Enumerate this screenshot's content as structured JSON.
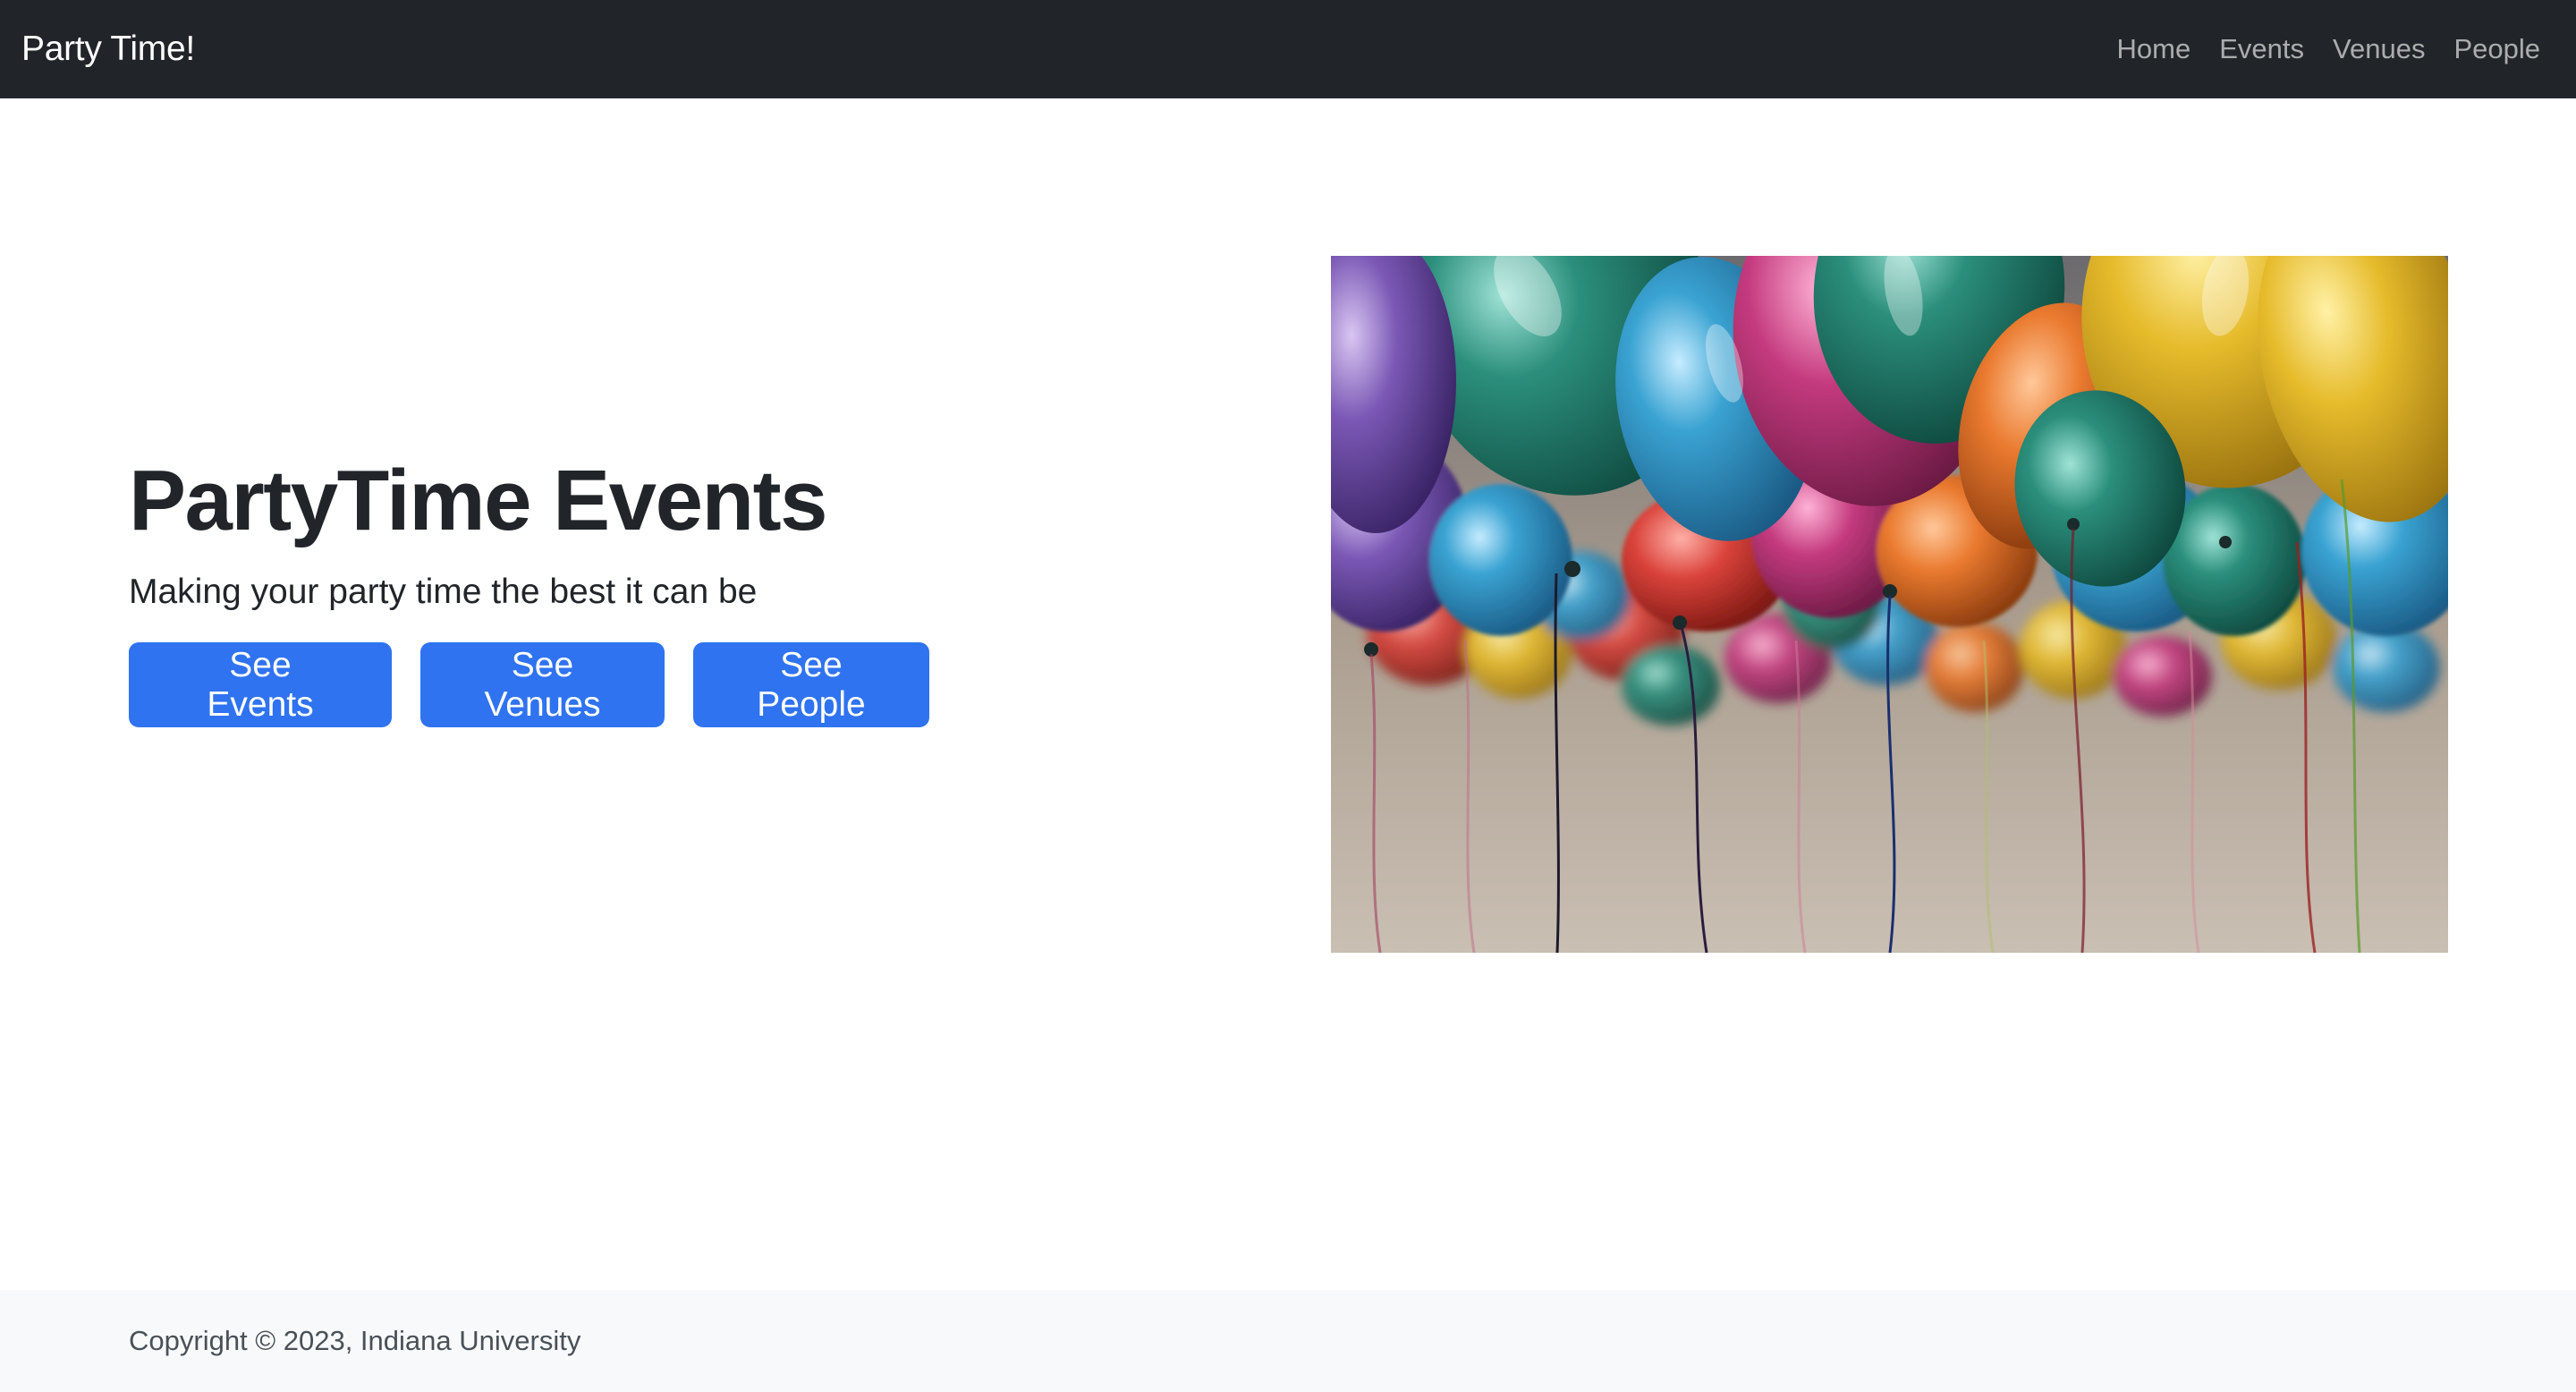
{
  "navbar": {
    "brand": "Party Time!",
    "links": [
      {
        "label": "Home"
      },
      {
        "label": "Events"
      },
      {
        "label": "Venues"
      },
      {
        "label": "People"
      }
    ]
  },
  "hero": {
    "title": "PartyTime Events",
    "subtitle": "Making your party time the best it can be",
    "buttons": [
      {
        "label": "See Events"
      },
      {
        "label": "See Venues"
      },
      {
        "label": "See People"
      }
    ],
    "image_subject": "colorful-balloons-photo"
  },
  "footer": {
    "copyright": "Copyright © 2023, Indiana University"
  },
  "colors": {
    "navbar_bg": "#212529",
    "primary": "#2f73f0",
    "footer_bg": "#f8f9fa"
  }
}
